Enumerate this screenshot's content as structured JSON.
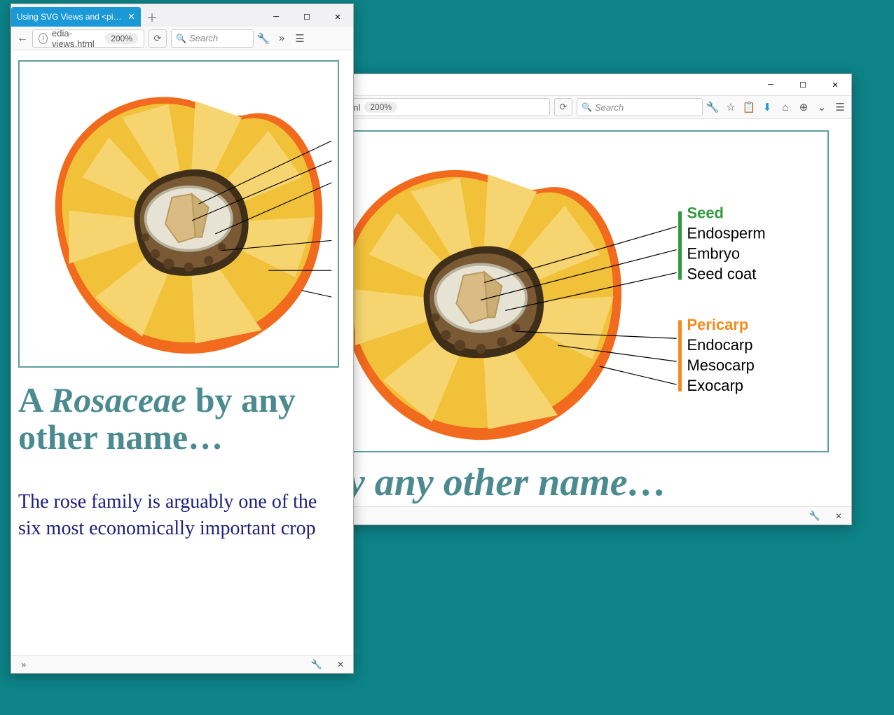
{
  "desktop_bg": "#0d8388",
  "window_back": {
    "url_display": "dia-views.html",
    "zoom": "200%",
    "search_placeholder": "Search",
    "title_genus": "Rosaceae",
    "title_prefix": "A ",
    "title_suffix_truncated": "e by any other name…"
  },
  "window_front": {
    "tab_title": "Using SVG Views and <picture>",
    "url_display": "edia-views.html",
    "zoom": "200%",
    "search_placeholder": "Search",
    "title_prefix": "A ",
    "title_genus": "Rosaceae",
    "title_suffix": " by any other name…",
    "body": "The rose family is arguably one of the six most economically important crop"
  },
  "diagram": {
    "seed_heading": "Seed",
    "seed_items": [
      "Endosperm",
      "Embryo",
      "Seed coat"
    ],
    "pericarp_heading": "Pericarp",
    "pericarp_items": [
      "Endocarp",
      "Mesocarp",
      "Exocarp"
    ],
    "colors": {
      "seed": "#2e9a3b",
      "pericarp": "#f38b1a",
      "exocarp": "#f16a1d",
      "mesocarp": "#f2c13a",
      "mesocarp_light": "#f6d571",
      "endocarp": "#6a4d2c",
      "seed_shell": "#e6e3d4"
    }
  }
}
